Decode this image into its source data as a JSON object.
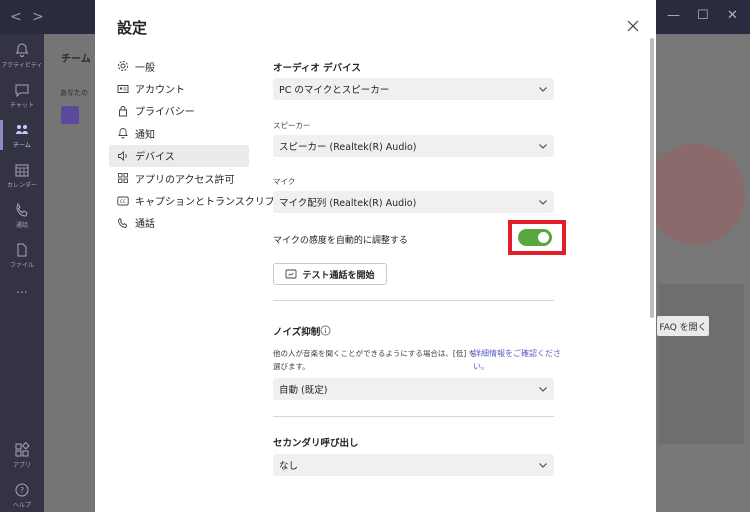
{
  "window": {
    "back": "<",
    "forward": ">",
    "minimize": "—",
    "maximize": "☐",
    "close": "✕"
  },
  "rail": [
    {
      "label": "アクティビティ",
      "icon": "bell-icon"
    },
    {
      "label": "チャット",
      "icon": "chat-icon"
    },
    {
      "label": "チーム",
      "icon": "teams-icon"
    },
    {
      "label": "カレンダー",
      "icon": "calendar-icon"
    },
    {
      "label": "通話",
      "icon": "phone-icon"
    },
    {
      "label": "ファイル",
      "icon": "file-icon"
    },
    {
      "label": "...",
      "icon": "more-icon"
    },
    {
      "label": "アプリ",
      "icon": "apps-icon"
    },
    {
      "label": "ヘルプ",
      "icon": "help-icon"
    }
  ],
  "background": {
    "teams_title": "チーム",
    "teams_sub": "あなたの",
    "faq_button": "FAQ を開く"
  },
  "dialog": {
    "title": "設定",
    "menu": [
      {
        "label": "一般",
        "icon": "gear-icon"
      },
      {
        "label": "アカウント",
        "icon": "account-icon"
      },
      {
        "label": "プライバシー",
        "icon": "lock-icon"
      },
      {
        "label": "通知",
        "icon": "bell-icon"
      },
      {
        "label": "デバイス",
        "icon": "speaker-icon"
      },
      {
        "label": "アプリのアクセス許可",
        "icon": "grid-icon"
      },
      {
        "label": "キャプションとトランスクリプト",
        "icon": "cc-icon"
      },
      {
        "label": "通話",
        "icon": "phone-icon"
      }
    ],
    "audio_device_label": "オーディオ デバイス",
    "audio_device_value": "PC のマイクとスピーカー",
    "speaker_label": "スピーカー",
    "speaker_value": "スピーカー (Realtek(R) Audio)",
    "mic_label": "マイク",
    "mic_value": "マイク配列 (Realtek(R) Audio)",
    "auto_adjust_label": "マイクの感度を自動的に調整する",
    "auto_adjust_on": true,
    "test_call_button": "テスト通話を開始",
    "noise_label": "ノイズ抑制",
    "noise_desc_line1": "他の人が音楽を聞くことができるようにする場合は、[低] を",
    "noise_desc_line2": "選びます。",
    "noise_link_line1": "詳細情報をご確認くださ",
    "noise_link_line2": "い。",
    "noise_value": "自動 (既定)",
    "secondary_label": "セカンダリ呼び出し",
    "secondary_value": "なし"
  },
  "colors": {
    "toggle_on": "#58a73f",
    "highlight": "#e21e2b",
    "link": "#5b5fc7"
  }
}
